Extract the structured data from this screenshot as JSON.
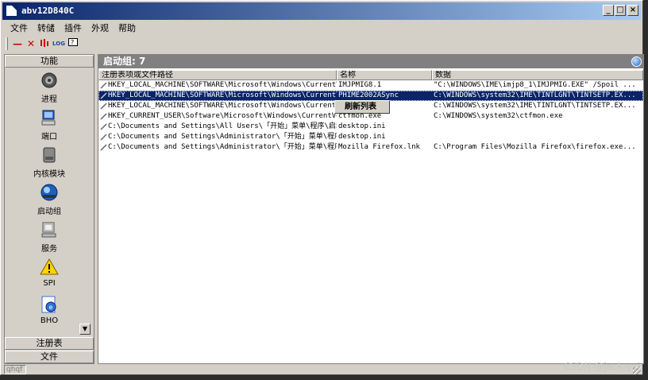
{
  "window": {
    "title": "abv12D840C",
    "btn_min": "_",
    "btn_max": "□",
    "btn_close": "×"
  },
  "menu": [
    "文件",
    "转储",
    "插件",
    "外观",
    "帮助"
  ],
  "toolbar": {
    "icons": [
      "minus-icon",
      "close-x-icon",
      "bars-icon",
      "log-icon",
      "help-icon"
    ],
    "log_label": "LOG"
  },
  "sidebar": {
    "header": "功能",
    "items": [
      {
        "label": "进程",
        "icon": "process-gear-icon"
      },
      {
        "label": "端口",
        "icon": "port-computer-icon"
      },
      {
        "label": "内核模块",
        "icon": "kernel-module-icon"
      },
      {
        "label": "启动组",
        "icon": "startup-globe-icon"
      },
      {
        "label": "服务",
        "icon": "service-computer-icon"
      },
      {
        "label": "SPI",
        "icon": "warning-icon"
      },
      {
        "label": "BHO",
        "icon": "bho-ie-icon"
      }
    ],
    "footer_registry": "注册表",
    "footer_file": "文件"
  },
  "main": {
    "group_header": "启动组: 7",
    "columns": [
      "注册表项或文件路径",
      "名称",
      "数据"
    ],
    "rows": [
      {
        "path": "HKEY_LOCAL_MACHINE\\SOFTWARE\\Microsoft\\Windows\\CurrentVersio...",
        "name": "IMJPMIG8.1",
        "data": "\"C:\\WINDOWS\\IME\\imjp8_1\\IMJPMIG.EXE\" /Spoil ..."
      },
      {
        "path": "HKEY_LOCAL_MACHINE\\SOFTWARE\\Microsoft\\Windows\\CurrentVersio...",
        "name": "PHIME2002ASync",
        "data": "C:\\WINDOWS\\system32\\IME\\TINTLGNT\\TINTSETP.EX..."
      },
      {
        "path": "HKEY_LOCAL_MACHINE\\SOFTWARE\\Microsoft\\Windows\\CurrentVersio...",
        "name": "",
        "data": "C:\\WINDOWS\\system32\\IME\\TINTLGNT\\TINTSETP.EX..."
      },
      {
        "path": "HKEY_CURRENT_USER\\Software\\Microsoft\\Windows\\CurrentVersion\\Run",
        "name": "ctfmon.exe",
        "data": "C:\\WINDOWS\\system32\\ctfmon.exe"
      },
      {
        "path": "C:\\Documents and Settings\\All Users\\「开始」菜单\\程序\\启动",
        "name": "desktop.ini",
        "data": ""
      },
      {
        "path": "C:\\Documents and Settings\\Administrator\\「开始」菜单\\程序\\启动",
        "name": "desktop.ini",
        "data": ""
      },
      {
        "path": "C:\\Documents and Settings\\Administrator\\「开始」菜单\\程序\\启动",
        "name": "Mozilla Firefox.lnk",
        "data": "C:\\Program Files\\Mozilla Firefox\\firefox.exe..."
      }
    ],
    "selected_row": 1,
    "context_menu_item": "刷新列表"
  },
  "status": {
    "left": "qhqf"
  },
  "watermark": "CSDN @jack-yyj",
  "colors": {
    "title_gradient_start": "#0a246a",
    "selection": "#0a246a",
    "face": "#d4d0c8",
    "group_header": "#808080"
  }
}
